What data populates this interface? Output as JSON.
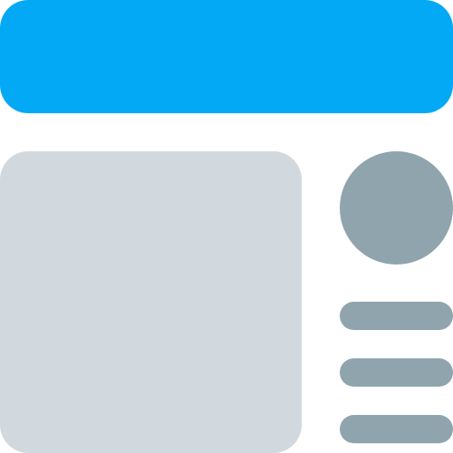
{
  "icon": {
    "name": "layout-template-icon",
    "colors": {
      "header": "#03A9F4",
      "panel": "#D1D9DF",
      "accent": "#90A4AE"
    },
    "elements": [
      "header-bar",
      "main-panel",
      "avatar-circle",
      "text-line",
      "text-line",
      "text-line"
    ]
  }
}
